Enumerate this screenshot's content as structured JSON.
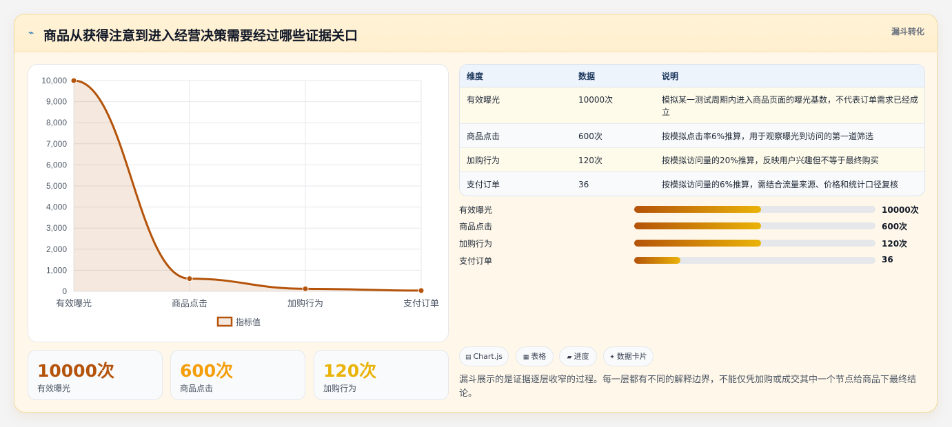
{
  "header": {
    "icon": "chart-line-icon",
    "title": "商品从获得注意到进入经营决策需要经过哪些证据关口",
    "tag": "漏斗转化"
  },
  "chart_data": {
    "type": "line",
    "categories": [
      "有效曝光",
      "商品点击",
      "加购行为",
      "支付订单"
    ],
    "series": [
      {
        "name": "指标值",
        "values": [
          10000,
          600,
          120,
          36
        ]
      }
    ],
    "ylim": [
      0,
      10000
    ],
    "yticks": [
      "0",
      "1,000",
      "2,000",
      "3,000",
      "4,000",
      "5,000",
      "6,000",
      "7,000",
      "8,000",
      "9,000",
      "10,000"
    ],
    "fill": true,
    "grid": true,
    "legend_position": "bottom",
    "color": "#b45309"
  },
  "stats": [
    {
      "value": "10000次",
      "label": "有效曝光",
      "color": "#b45309"
    },
    {
      "value": "600次",
      "label": "商品点击",
      "color": "#f59e0b"
    },
    {
      "value": "120次",
      "label": "加购行为",
      "color": "#eab308"
    }
  ],
  "table": {
    "headers": [
      "维度",
      "数据",
      "说明"
    ],
    "rows": [
      {
        "dim": "有效曝光",
        "data": "10000次",
        "desc": "模拟某一测试周期内进入商品页面的曝光基数，不代表订单需求已经成立"
      },
      {
        "dim": "商品点击",
        "data": "600次",
        "desc": "按模拟点击率6%推算，用于观察曝光到访问的第一道筛选"
      },
      {
        "dim": "加购行为",
        "data": "120次",
        "desc": "按模拟访问量的20%推算，反映用户兴趣但不等于最终购买"
      },
      {
        "dim": "支付订单",
        "data": "36",
        "desc": "按模拟访问量的6%推算，需结合流量来源、价格和统计口径复核"
      }
    ]
  },
  "progress": [
    {
      "label": "有效曝光",
      "value": "10000次",
      "fraction": 0.525
    },
    {
      "label": "商品点击",
      "value": "600次",
      "fraction": 0.525
    },
    {
      "label": "加购行为",
      "value": "120次",
      "fraction": 0.525
    },
    {
      "label": "支付订单",
      "value": "36",
      "fraction": 0.19
    }
  ],
  "chips": [
    {
      "icon": "chart-icon",
      "label": "Chart.js"
    },
    {
      "icon": "table-icon",
      "label": "表格"
    },
    {
      "icon": "progress-icon",
      "label": "进度"
    },
    {
      "icon": "sparkle-icon",
      "label": "数据卡片"
    }
  ],
  "footnote": "漏斗展示的是证据逐层收窄的过程。每一层都有不同的解释边界，不能仅凭加购或成交其中一个节点给商品下最终结论。"
}
